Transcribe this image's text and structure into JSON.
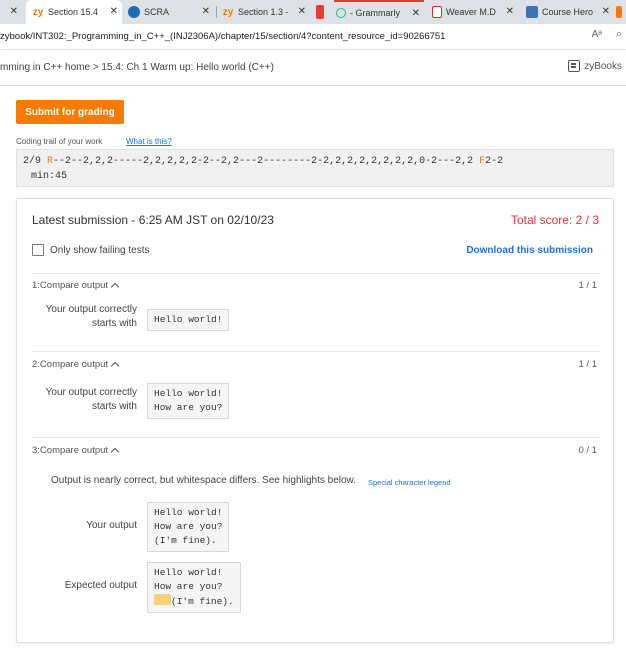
{
  "browser": {
    "tabs": [
      {
        "label": "",
        "icon": "tab-fragment-icon"
      },
      {
        "label": "Section 15.4",
        "icon": "zybooks-icon",
        "active": true
      },
      {
        "label": "SCRA",
        "icon": "globe-icon"
      },
      {
        "label": "Section 1.3 -",
        "icon": "zybooks-icon"
      },
      {
        "label": "",
        "icon": "red-app-icon"
      },
      {
        "label": "- Grammarly",
        "icon": "grammarly-icon"
      },
      {
        "label": "Weaver M.D",
        "icon": "pdf-icon"
      },
      {
        "label": "Course Hero",
        "icon": "coursehero-icon"
      }
    ],
    "url": "zybook/INT302:_Programming_in_C++_(INJ2306A)/chapter/15/section/4?content_resource_id=90266751",
    "reader_mode": "Aᵃ",
    "zoom_icon": "⌕"
  },
  "header": {
    "breadcrumb": "mming in C++ home > 15.4: Ch 1 Warm up: Hello world (C++)",
    "brand": "zyBooks"
  },
  "submit_label": "Submit for grading",
  "trail": {
    "label": "Coding trail of your work",
    "link": "What is this?",
    "line1_a": "2/9 ",
    "line1_r": "R",
    "line1_b": "--2--2,2,2-----2,2,2,2,2-2--2,2---2--------2-2,2,2,2,2,2,2,2,0-2---2,2 ",
    "line1_f": "F",
    "line1_c": "2-2",
    "line2": "min:45"
  },
  "submission": {
    "title": "Latest submission - 6:25 AM JST on 02/10/23",
    "score": "Total score: 2 / 3",
    "only_failing": "Only show failing tests",
    "download": "Download this submission",
    "tests": [
      {
        "header": "1:Compare output",
        "points": "1 / 1",
        "label": "Your output correctly starts with",
        "output": "Hello world!"
      },
      {
        "header": "2:Compare output",
        "points": "1 / 1",
        "label": "Your output correctly starts with",
        "output": "Hello world!\nHow are you?"
      },
      {
        "header": "3:Compare output",
        "points": "0 / 1",
        "message": "Output is nearly correct, but whitespace differs. See highlights below.",
        "legend_link": "Special character legend",
        "your_label": "Your output",
        "your_output": "Hello world!\nHow are you?\n(I'm fine).",
        "expected_label": "Expected output",
        "expected_l1": "Hello world!",
        "expected_l2": "How are you?",
        "expected_l3": "(I'm fine)."
      }
    ]
  },
  "colors": {
    "accent": "#f57c00",
    "link": "#1a73e8",
    "score": "#e53935",
    "highlight": "#f6d27a"
  }
}
